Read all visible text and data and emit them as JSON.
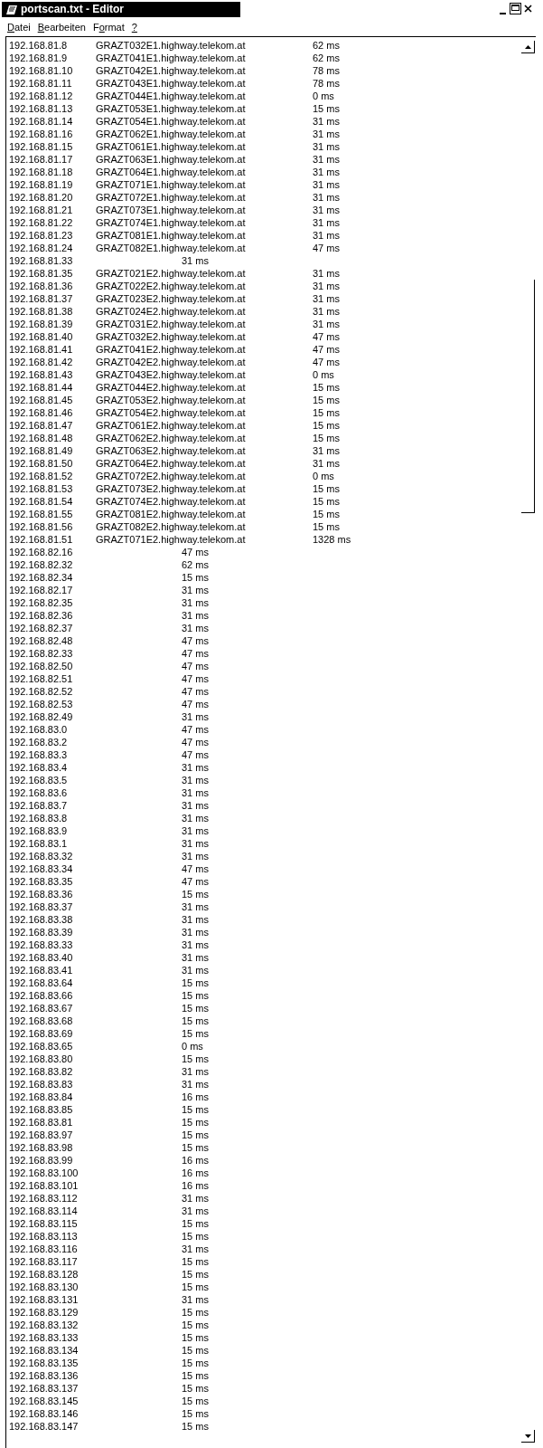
{
  "window": {
    "title": "portscan.txt - Editor"
  },
  "menu": [
    {
      "parts": [
        {
          "text": "D",
          "underlined": true
        },
        {
          "text": "atei",
          "underlined": false
        }
      ]
    },
    {
      "parts": [
        {
          "text": "B",
          "underlined": true
        },
        {
          "text": "earbeiten",
          "underlined": false
        }
      ]
    },
    {
      "parts": [
        {
          "text": "F",
          "underlined": false
        },
        {
          "text": "o",
          "underlined": true
        },
        {
          "text": "rmat",
          "underlined": false
        }
      ]
    },
    {
      "parts": [
        {
          "text": "?",
          "underlined": true
        }
      ]
    }
  ],
  "lines": [
    {
      "kind": "host",
      "ip": "192.168.81.8",
      "host": "GRAZT032E1.highway.telekom.at",
      "ping": "62 ms"
    },
    {
      "kind": "host",
      "ip": "192.168.81.9",
      "host": "GRAZT041E1.highway.telekom.at",
      "ping": "62 ms"
    },
    {
      "kind": "host",
      "ip": "192.168.81.10",
      "host": "GRAZT042E1.highway.telekom.at",
      "ping": "78 ms"
    },
    {
      "kind": "host",
      "ip": "192.168.81.11",
      "host": "GRAZT043E1.highway.telekom.at",
      "ping": "78 ms"
    },
    {
      "kind": "host",
      "ip": "192.168.81.12",
      "host": "GRAZT044E1.highway.telekom.at",
      "ping": "0 ms"
    },
    {
      "kind": "host",
      "ip": "192.168.81.13",
      "host": "GRAZT053E1.highway.telekom.at",
      "ping": "15 ms"
    },
    {
      "kind": "host",
      "ip": "192.168.81.14",
      "host": "GRAZT054E1.highway.telekom.at",
      "ping": "31 ms"
    },
    {
      "kind": "host",
      "ip": "192.168.81.16",
      "host": "GRAZT062E1.highway.telekom.at",
      "ping": "31 ms"
    },
    {
      "kind": "host",
      "ip": "192.168.81.15",
      "host": "GRAZT061E1.highway.telekom.at",
      "ping": "31 ms"
    },
    {
      "kind": "host",
      "ip": "192.168.81.17",
      "host": "GRAZT063E1.highway.telekom.at",
      "ping": "31 ms"
    },
    {
      "kind": "host",
      "ip": "192.168.81.18",
      "host": "GRAZT064E1.highway.telekom.at",
      "ping": "31 ms"
    },
    {
      "kind": "host",
      "ip": "192.168.81.19",
      "host": "GRAZT071E1.highway.telekom.at",
      "ping": "31 ms"
    },
    {
      "kind": "host",
      "ip": "192.168.81.20",
      "host": "GRAZT072E1.highway.telekom.at",
      "ping": "31 ms"
    },
    {
      "kind": "host",
      "ip": "192.168.81.21",
      "host": "GRAZT073E1.highway.telekom.at",
      "ping": "31 ms"
    },
    {
      "kind": "host",
      "ip": "192.168.81.22",
      "host": "GRAZT074E1.highway.telekom.at",
      "ping": "31 ms"
    },
    {
      "kind": "host",
      "ip": "192.168.81.23",
      "host": "GRAZT081E1.highway.telekom.at",
      "ping": "31 ms"
    },
    {
      "kind": "host",
      "ip": "192.168.81.24",
      "host": "GRAZT082E1.highway.telekom.at",
      "ping": "47 ms"
    },
    {
      "kind": "ping",
      "ip": "192.168.81.33",
      "ping": "31 ms"
    },
    {
      "kind": "host",
      "ip": "192.168.81.35",
      "host": "GRAZT021E2.highway.telekom.at",
      "ping": "31 ms"
    },
    {
      "kind": "host",
      "ip": "192.168.81.36",
      "host": "GRAZT022E2.highway.telekom.at",
      "ping": "31 ms"
    },
    {
      "kind": "host",
      "ip": "192.168.81.37",
      "host": "GRAZT023E2.highway.telekom.at",
      "ping": "31 ms"
    },
    {
      "kind": "host",
      "ip": "192.168.81.38",
      "host": "GRAZT024E2.highway.telekom.at",
      "ping": "31 ms"
    },
    {
      "kind": "host",
      "ip": "192.168.81.39",
      "host": "GRAZT031E2.highway.telekom.at",
      "ping": "31 ms"
    },
    {
      "kind": "host",
      "ip": "192.168.81.40",
      "host": "GRAZT032E2.highway.telekom.at",
      "ping": "47 ms"
    },
    {
      "kind": "host",
      "ip": "192.168.81.41",
      "host": "GRAZT041E2.highway.telekom.at",
      "ping": "47 ms"
    },
    {
      "kind": "host",
      "ip": "192.168.81.42",
      "host": "GRAZT042E2.highway.telekom.at",
      "ping": "47 ms"
    },
    {
      "kind": "host",
      "ip": "192.168.81.43",
      "host": "GRAZT043E2.highway.telekom.at",
      "ping": "0 ms"
    },
    {
      "kind": "host",
      "ip": "192.168.81.44",
      "host": "GRAZT044E2.highway.telekom.at",
      "ping": "15 ms"
    },
    {
      "kind": "host",
      "ip": "192.168.81.45",
      "host": "GRAZT053E2.highway.telekom.at",
      "ping": "15 ms"
    },
    {
      "kind": "host",
      "ip": "192.168.81.46",
      "host": "GRAZT054E2.highway.telekom.at",
      "ping": "15 ms"
    },
    {
      "kind": "host",
      "ip": "192.168.81.47",
      "host": "GRAZT061E2.highway.telekom.at",
      "ping": "15 ms"
    },
    {
      "kind": "host",
      "ip": "192.168.81.48",
      "host": "GRAZT062E2.highway.telekom.at",
      "ping": "15 ms"
    },
    {
      "kind": "host",
      "ip": "192.168.81.49",
      "host": "GRAZT063E2.highway.telekom.at",
      "ping": "31 ms"
    },
    {
      "kind": "host",
      "ip": "192.168.81.50",
      "host": "GRAZT064E2.highway.telekom.at",
      "ping": "31 ms"
    },
    {
      "kind": "host",
      "ip": "192.168.81.52",
      "host": "GRAZT072E2.highway.telekom.at",
      "ping": "0 ms"
    },
    {
      "kind": "host",
      "ip": "192.168.81.53",
      "host": "GRAZT073E2.highway.telekom.at",
      "ping": "15 ms"
    },
    {
      "kind": "host",
      "ip": "192.168.81.54",
      "host": "GRAZT074E2.highway.telekom.at",
      "ping": "15 ms"
    },
    {
      "kind": "host",
      "ip": "192.168.81.55",
      "host": "GRAZT081E2.highway.telekom.at",
      "ping": "15 ms"
    },
    {
      "kind": "host",
      "ip": "192.168.81.56",
      "host": "GRAZT082E2.highway.telekom.at",
      "ping": "15 ms"
    },
    {
      "kind": "host",
      "ip": "192.168.81.51",
      "host": "GRAZT071E2.highway.telekom.at",
      "ping": "1328 ms"
    },
    {
      "kind": "ping",
      "ip": "192.168.82.16",
      "ping": "47 ms"
    },
    {
      "kind": "ping",
      "ip": "192.168.82.32",
      "ping": "62 ms"
    },
    {
      "kind": "ping",
      "ip": "192.168.82.34",
      "ping": "15 ms"
    },
    {
      "kind": "ping",
      "ip": "192.168.82.17",
      "ping": "31 ms"
    },
    {
      "kind": "ping",
      "ip": "192.168.82.35",
      "ping": "31 ms"
    },
    {
      "kind": "ping",
      "ip": "192.168.82.36",
      "ping": "31 ms"
    },
    {
      "kind": "ping",
      "ip": "192.168.82.37",
      "ping": "31 ms"
    },
    {
      "kind": "ping",
      "ip": "192.168.82.48",
      "ping": "47 ms"
    },
    {
      "kind": "ping",
      "ip": "192.168.82.33",
      "ping": "47 ms"
    },
    {
      "kind": "ping",
      "ip": "192.168.82.50",
      "ping": "47 ms"
    },
    {
      "kind": "ping",
      "ip": "192.168.82.51",
      "ping": "47 ms"
    },
    {
      "kind": "ping",
      "ip": "192.168.82.52",
      "ping": "47 ms"
    },
    {
      "kind": "ping",
      "ip": "192.168.82.53",
      "ping": "47 ms"
    },
    {
      "kind": "ping",
      "ip": "192.168.82.49",
      "ping": "31 ms"
    },
    {
      "kind": "ping",
      "ip": "192.168.83.0",
      "ping": "47 ms"
    },
    {
      "kind": "ping",
      "ip": "192.168.83.2",
      "ping": "47 ms"
    },
    {
      "kind": "ping",
      "ip": "192.168.83.3",
      "ping": "47 ms"
    },
    {
      "kind": "ping",
      "ip": "192.168.83.4",
      "ping": "31 ms"
    },
    {
      "kind": "ping",
      "ip": "192.168.83.5",
      "ping": "31 ms"
    },
    {
      "kind": "ping",
      "ip": "192.168.83.6",
      "ping": "31 ms"
    },
    {
      "kind": "ping",
      "ip": "192.168.83.7",
      "ping": "31 ms"
    },
    {
      "kind": "ping",
      "ip": "192.168.83.8",
      "ping": "31 ms"
    },
    {
      "kind": "ping",
      "ip": "192.168.83.9",
      "ping": "31 ms"
    },
    {
      "kind": "ping",
      "ip": "192.168.83.1",
      "ping": "31 ms"
    },
    {
      "kind": "ping",
      "ip": "192.168.83.32",
      "ping": "31 ms"
    },
    {
      "kind": "ping",
      "ip": "192.168.83.34",
      "ping": "47 ms"
    },
    {
      "kind": "ping",
      "ip": "192.168.83.35",
      "ping": "47 ms"
    },
    {
      "kind": "ping",
      "ip": "192.168.83.36",
      "ping": "15 ms"
    },
    {
      "kind": "ping",
      "ip": "192.168.83.37",
      "ping": "31 ms"
    },
    {
      "kind": "ping",
      "ip": "192.168.83.38",
      "ping": "31 ms"
    },
    {
      "kind": "ping",
      "ip": "192.168.83.39",
      "ping": "31 ms"
    },
    {
      "kind": "ping",
      "ip": "192.168.83.33",
      "ping": "31 ms"
    },
    {
      "kind": "ping",
      "ip": "192.168.83.40",
      "ping": "31 ms"
    },
    {
      "kind": "ping",
      "ip": "192.168.83.41",
      "ping": "31 ms"
    },
    {
      "kind": "ping",
      "ip": "192.168.83.64",
      "ping": "15 ms"
    },
    {
      "kind": "ping",
      "ip": "192.168.83.66",
      "ping": "15 ms"
    },
    {
      "kind": "ping",
      "ip": "192.168.83.67",
      "ping": "15 ms"
    },
    {
      "kind": "ping",
      "ip": "192.168.83.68",
      "ping": "15 ms"
    },
    {
      "kind": "ping",
      "ip": "192.168.83.69",
      "ping": "15 ms"
    },
    {
      "kind": "ping",
      "ip": "192.168.83.65",
      "ping": "0 ms"
    },
    {
      "kind": "ping",
      "ip": "192.168.83.80",
      "ping": "15 ms"
    },
    {
      "kind": "ping",
      "ip": "192.168.83.82",
      "ping": "31 ms"
    },
    {
      "kind": "ping",
      "ip": "192.168.83.83",
      "ping": "31 ms"
    },
    {
      "kind": "ping",
      "ip": "192.168.83.84",
      "ping": "16 ms"
    },
    {
      "kind": "ping",
      "ip": "192.168.83.85",
      "ping": "15 ms"
    },
    {
      "kind": "ping",
      "ip": "192.168.83.81",
      "ping": "15 ms"
    },
    {
      "kind": "ping",
      "ip": "192.168.83.97",
      "ping": "15 ms"
    },
    {
      "kind": "ping",
      "ip": "192.168.83.98",
      "ping": "15 ms"
    },
    {
      "kind": "ping",
      "ip": "192.168.83.99",
      "ping": "16 ms"
    },
    {
      "kind": "ping",
      "ip": "192.168.83.100",
      "ping": "16 ms"
    },
    {
      "kind": "ping",
      "ip": "192.168.83.101",
      "ping": "16 ms"
    },
    {
      "kind": "ping",
      "ip": "192.168.83.112",
      "ping": "31 ms"
    },
    {
      "kind": "ping",
      "ip": "192.168.83.114",
      "ping": "31 ms"
    },
    {
      "kind": "ping",
      "ip": "192.168.83.115",
      "ping": "15 ms"
    },
    {
      "kind": "ping",
      "ip": "192.168.83.113",
      "ping": "15 ms"
    },
    {
      "kind": "ping",
      "ip": "192.168.83.116",
      "ping": "31 ms"
    },
    {
      "kind": "ping",
      "ip": "192.168.83.117",
      "ping": "15 ms"
    },
    {
      "kind": "ping",
      "ip": "192.168.83.128",
      "ping": "15 ms"
    },
    {
      "kind": "ping",
      "ip": "192.168.83.130",
      "ping": "15 ms"
    },
    {
      "kind": "ping",
      "ip": "192.168.83.131",
      "ping": "31 ms"
    },
    {
      "kind": "ping",
      "ip": "192.168.83.129",
      "ping": "15 ms"
    },
    {
      "kind": "ping",
      "ip": "192.168.83.132",
      "ping": "15 ms"
    },
    {
      "kind": "ping",
      "ip": "192.168.83.133",
      "ping": "15 ms"
    },
    {
      "kind": "ping",
      "ip": "192.168.83.134",
      "ping": "15 ms"
    },
    {
      "kind": "ping",
      "ip": "192.168.83.135",
      "ping": "15 ms"
    },
    {
      "kind": "ping",
      "ip": "192.168.83.136",
      "ping": "15 ms"
    },
    {
      "kind": "ping",
      "ip": "192.168.83.137",
      "ping": "15 ms"
    },
    {
      "kind": "ping",
      "ip": "192.168.83.145",
      "ping": "15 ms"
    },
    {
      "kind": "ping",
      "ip": "192.168.83.146",
      "ping": "15 ms"
    },
    {
      "kind": "ping",
      "ip": "192.168.83.147",
      "ping": "15 ms"
    }
  ]
}
